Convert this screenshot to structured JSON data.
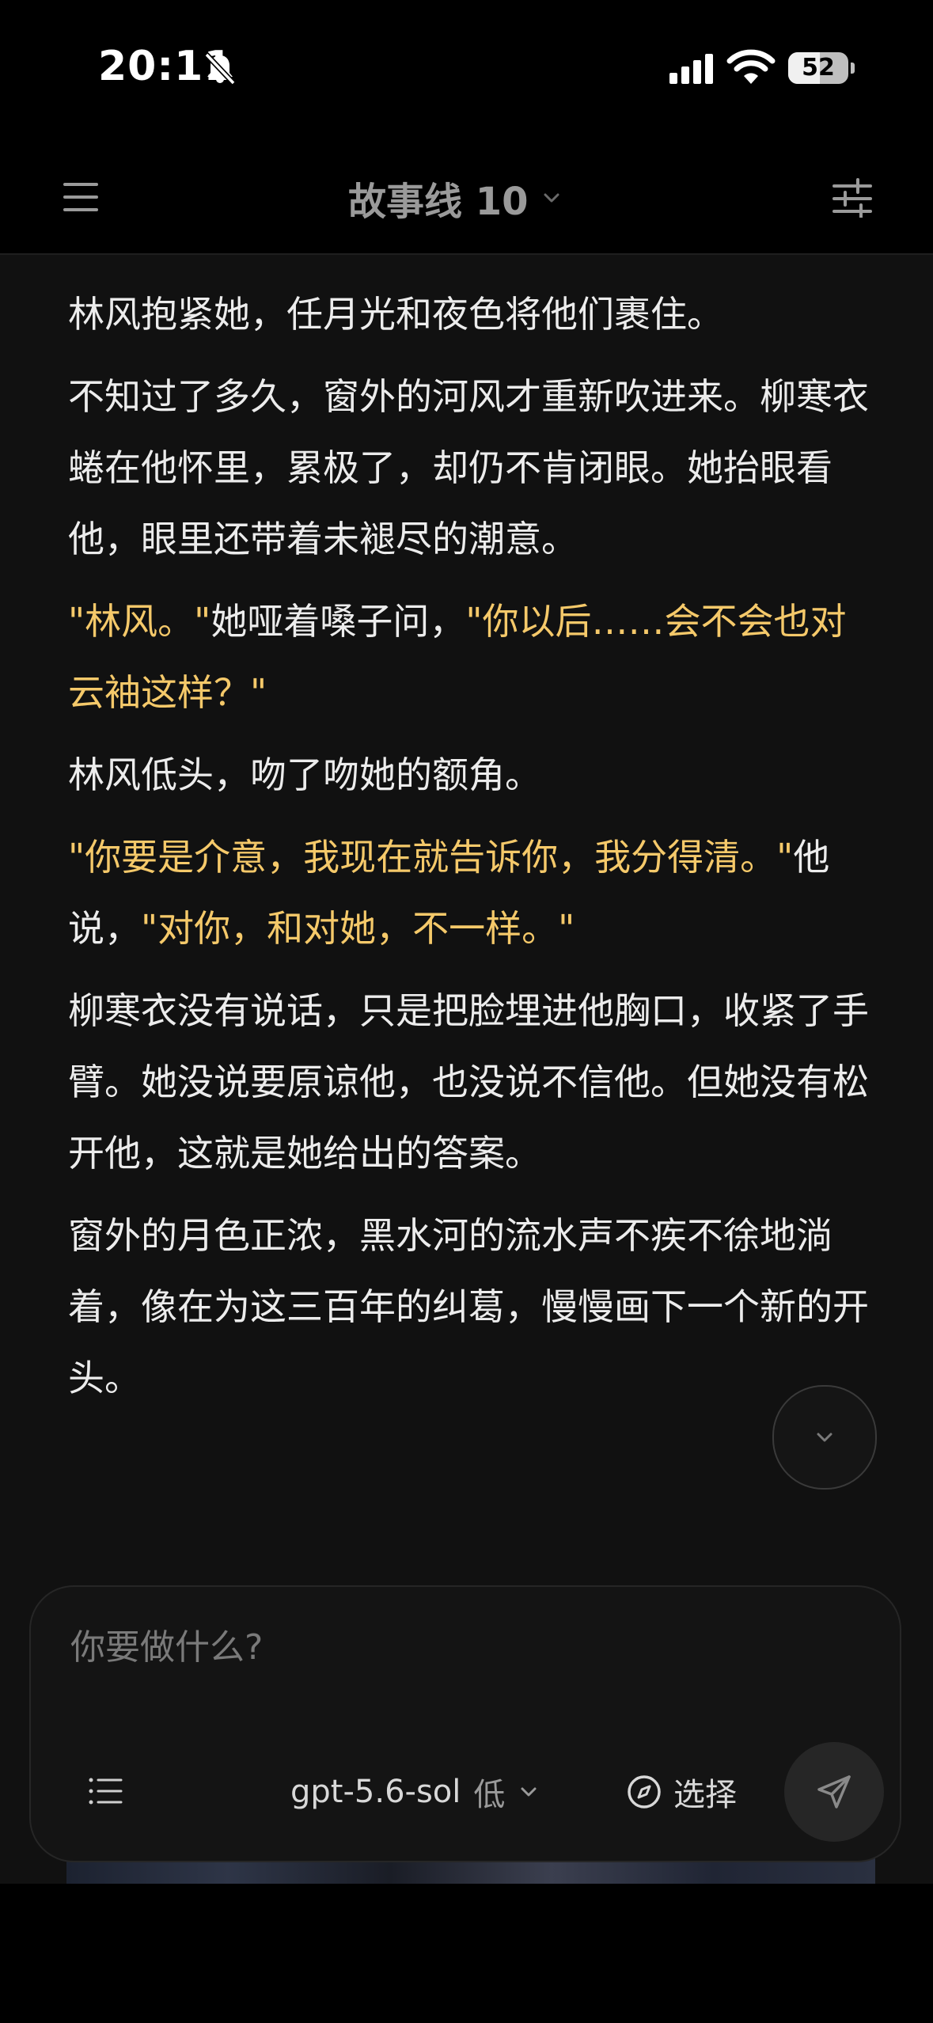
{
  "status_bar": {
    "time": "20:11",
    "battery_level": "52",
    "battery_fraction": 0.52,
    "icons": [
      "bell-slash-icon",
      "cellular-signal-icon",
      "wifi-icon",
      "battery-icon"
    ]
  },
  "header": {
    "title": "故事线 10",
    "left_icon": "menu-icon",
    "title_icon": "chevron-down-icon",
    "right_icon": "sliders-icon"
  },
  "story": {
    "paragraphs": [
      {
        "segments": [
          {
            "text": "林风抱紧她，任月光和夜色将他们裹住。",
            "quote": false
          }
        ]
      },
      {
        "segments": [
          {
            "text": "不知过了多久，窗外的河风才重新吹进来。柳寒衣蜷在他怀里，累极了，却仍不肯闭眼。她抬眼看他，眼里还带着未褪尽的潮意。",
            "quote": false
          }
        ]
      },
      {
        "segments": [
          {
            "text": "\"林风。\"",
            "quote": true
          },
          {
            "text": "她哑着嗓子问，",
            "quote": false
          },
          {
            "text": "\"你以后……会不会也对云袖这样？\"",
            "quote": true
          }
        ]
      },
      {
        "segments": [
          {
            "text": "林风低头，吻了吻她的额角。",
            "quote": false
          }
        ]
      },
      {
        "segments": [
          {
            "text": "\"你要是介意，我现在就告诉你，我分得清。\"",
            "quote": true
          },
          {
            "text": "他说，",
            "quote": false
          },
          {
            "text": "\"对你，和对她，不一样。\"",
            "quote": true
          }
        ]
      },
      {
        "segments": [
          {
            "text": "柳寒衣没有说话，只是把脸埋进他胸口，收紧了手臂。她没说要原谅他，也没说不信他。但她没有松开他，这就是她给出的答案。",
            "quote": false
          }
        ]
      },
      {
        "segments": [
          {
            "text": "窗外的月色正浓，黑水河的流水声不疾不徐地淌着，像在为这三百年的纠葛，慢慢画下一个新的开头。",
            "quote": false
          }
        ]
      }
    ]
  },
  "composer": {
    "placeholder": "你要做什么?",
    "value": "",
    "model_name": "gpt-5.6-sol",
    "model_effort": "低",
    "select_label": "选择"
  },
  "colors": {
    "background": "#000000",
    "content_background": "#111111",
    "text": "#ececec",
    "quote": "#f5c96a",
    "title": "#9a9a9a"
  }
}
